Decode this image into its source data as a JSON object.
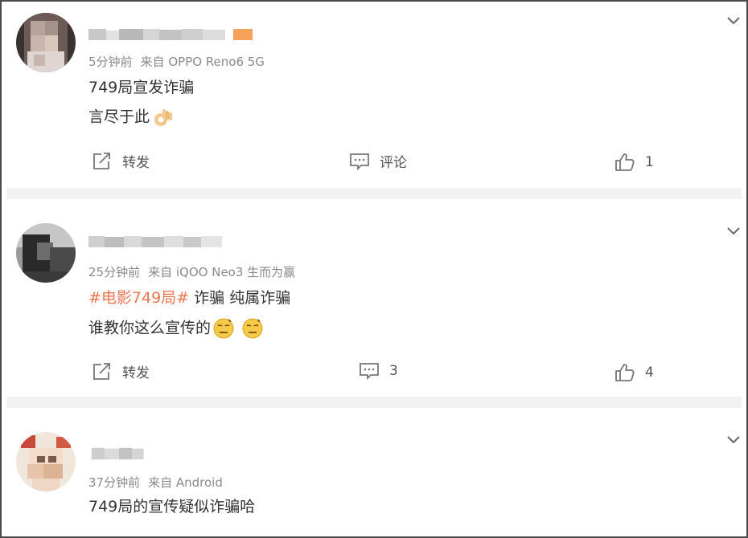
{
  "comments": [
    {
      "meta_time": "5分钟前",
      "meta_source": "来自 OPPO Reno6 5G",
      "line1": "749局宣发诈骗",
      "line2": "言尽于此",
      "line2_emoji": "ok-hand-emoji",
      "actions": {
        "forward": "转发",
        "comment": "评论",
        "like": "1"
      }
    },
    {
      "meta_time": "25分钟前",
      "meta_source": "来自 iQOO Neo3 生而为赢",
      "line1_tag": "#电影749局#",
      "line1_rest": " 诈骗 纯属诈骗",
      "line2": "谁教你这么宣传的",
      "line2_emoji": "dizzy-face-emoji",
      "actions": {
        "forward": "转发",
        "comment": "3",
        "like": "4"
      }
    },
    {
      "meta_time": "37分钟前",
      "meta_source": "来自 Android",
      "line1": "749局的宣传疑似诈骗哈"
    }
  ],
  "colors": {
    "topic_tag": "#eb7350",
    "meta_text": "#8a8a8a",
    "body_text": "#333333",
    "divider": "#f2f2f2",
    "icon": "#777777",
    "vip_badge": "#f5a35b"
  },
  "icons": [
    "chevron-down-icon",
    "forward-icon",
    "comment-icon",
    "like-icon"
  ]
}
